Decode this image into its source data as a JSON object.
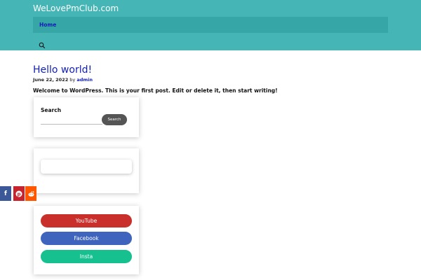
{
  "site": {
    "title": "WeLovePmClub.com"
  },
  "nav": {
    "home": "Home"
  },
  "post": {
    "title": "Hello world!",
    "date": "June 22, 2022",
    "by": "by",
    "author": "admin",
    "body": "Welcome to WordPress. This is your first post. Edit or delete it, then start writing!"
  },
  "search_widget": {
    "title": "Search",
    "button": "Search"
  },
  "social_buttons": {
    "youtube": "YouTube",
    "facebook": "Facebook",
    "insta": "Insta"
  },
  "share_bar": {
    "facebook": "f",
    "pinterest": "p",
    "reddit": "r"
  },
  "colors": {
    "header_bg": "#45b5b5",
    "nav_bg": "#36a6a6",
    "link": "#1320b8",
    "youtube": "#c9302c",
    "facebook": "#3f64bd",
    "insta": "#16c08f"
  }
}
